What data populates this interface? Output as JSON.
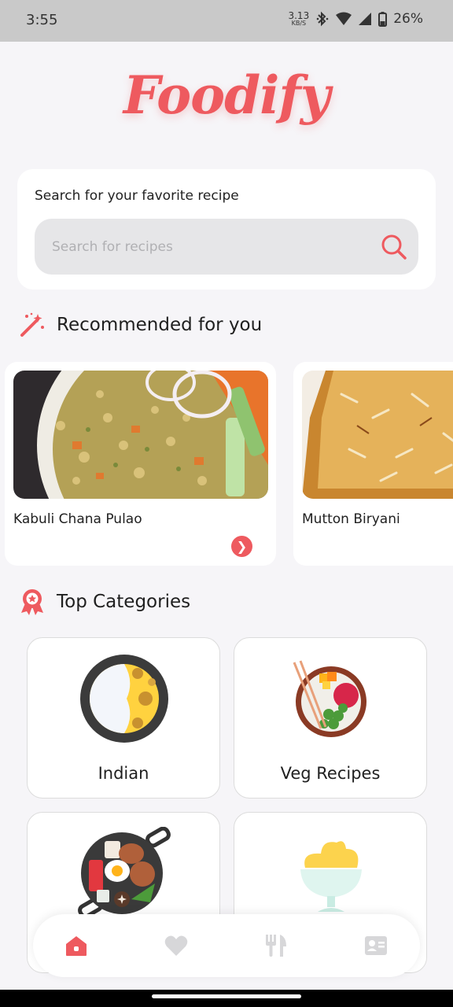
{
  "status_bar": {
    "time": "3:55",
    "net_speed": "3.13",
    "net_unit": "KB/S",
    "battery": "26%"
  },
  "app": {
    "logo_text": "Foodify",
    "accent_color": "#ee5a5f"
  },
  "search": {
    "title": "Search for your favorite recipe",
    "placeholder": "Search for recipes"
  },
  "recommended": {
    "title": "Recommended for you",
    "icon": "magic-wand-icon",
    "items": [
      {
        "name": "Kabuli Chana Pulao"
      },
      {
        "name": "Mutton Biryani"
      }
    ]
  },
  "categories": {
    "title": "Top Categories",
    "icon": "award-icon",
    "items": [
      {
        "label": "Indian",
        "icon": "curry-plate-icon"
      },
      {
        "label": "Veg Recipes",
        "icon": "veg-bowl-icon"
      },
      {
        "label": "",
        "icon": "breakfast-pan-icon"
      },
      {
        "label": "",
        "icon": "dessert-cup-icon"
      }
    ]
  },
  "bottom_nav": {
    "items": [
      {
        "icon": "home-icon",
        "active": true
      },
      {
        "icon": "heart-icon",
        "active": false
      },
      {
        "icon": "fork-knife-icon",
        "active": false
      },
      {
        "icon": "profile-card-icon",
        "active": false
      }
    ]
  }
}
